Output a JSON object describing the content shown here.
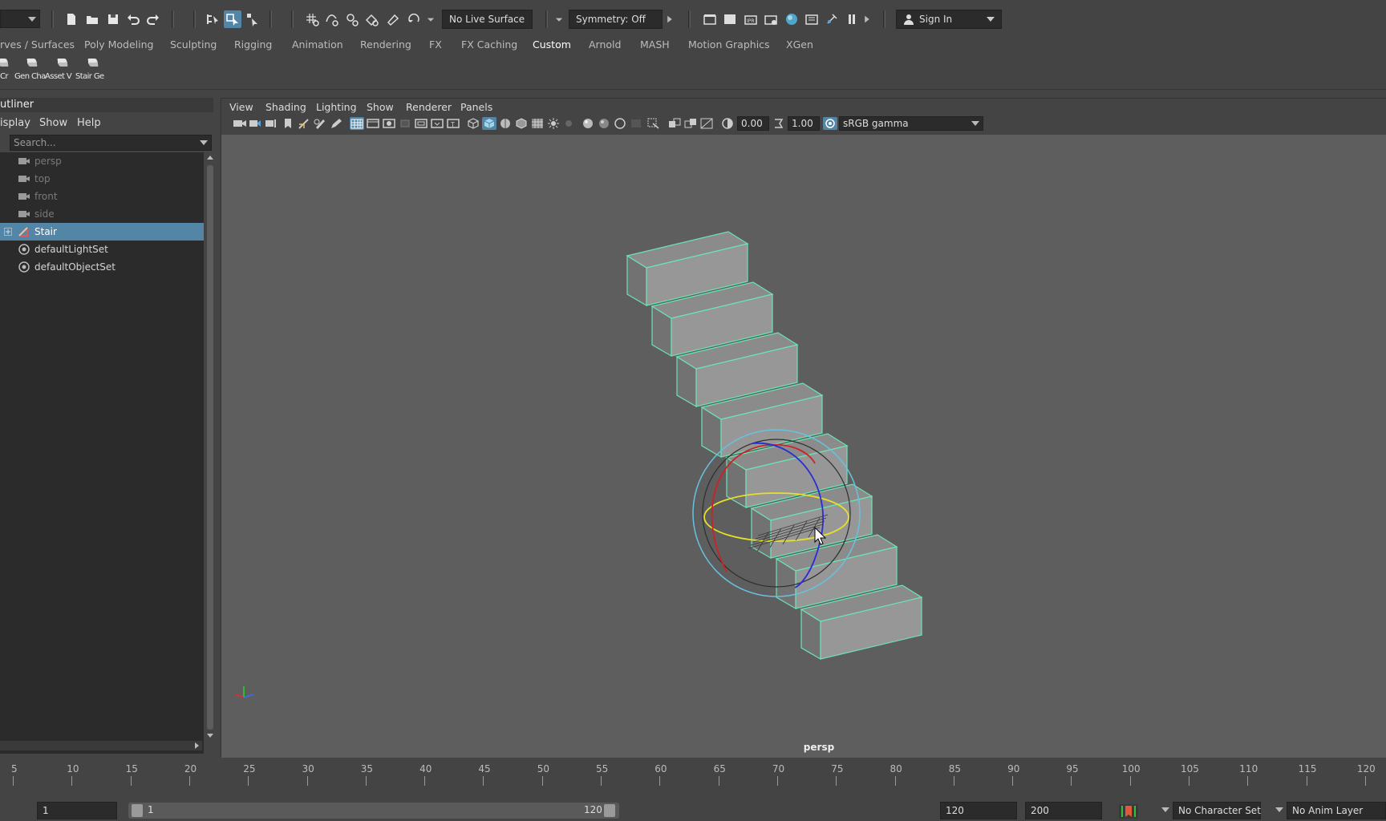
{
  "status_line": {
    "live_surface": "No Live Surface",
    "symmetry": "Symmetry: Off",
    "sign_in": "Sign In"
  },
  "shelf_tabs": [
    "rves / Surfaces",
    "Poly Modeling",
    "Sculpting",
    "Rigging",
    "Animation",
    "Rendering",
    "FX",
    "FX Caching",
    "Custom",
    "Arnold",
    "MASH",
    "Motion Graphics",
    "XGen"
  ],
  "shelf_active_tab": "Custom",
  "shelf_buttons": [
    "Cr",
    "Gen Cha",
    "Asset V",
    "Stair Ge"
  ],
  "outliner": {
    "title": "utliner",
    "menu": [
      "isplay",
      "Show",
      "Help"
    ],
    "search_placeholder": "Search...",
    "items": [
      {
        "label": "persp",
        "type": "camera"
      },
      {
        "label": "top",
        "type": "camera"
      },
      {
        "label": "front",
        "type": "camera"
      },
      {
        "label": "side",
        "type": "camera"
      },
      {
        "label": "Stair",
        "type": "transform",
        "selected": true
      },
      {
        "label": "defaultLightSet",
        "type": "set"
      },
      {
        "label": "defaultObjectSet",
        "type": "set"
      }
    ]
  },
  "viewport": {
    "menu": [
      "View",
      "Shading",
      "Lighting",
      "Show",
      "Renderer",
      "Panels"
    ],
    "exposure": "0.00",
    "gamma": "1.00",
    "color_space": "sRGB gamma",
    "camera_label": "persp"
  },
  "timeline": {
    "ticks": [
      "5",
      "10",
      "15",
      "20",
      "25",
      "30",
      "35",
      "40",
      "45",
      "50",
      "55",
      "60",
      "65",
      "70",
      "75",
      "80",
      "85",
      "90",
      "95",
      "100",
      "105",
      "110",
      "115",
      "120"
    ]
  },
  "range": {
    "current_frame": "1",
    "range_start": "1",
    "range_end": "120",
    "anim_end": "120",
    "anim_max": "200",
    "character_set": "No Character Set",
    "anim_layer": "No Anim Layer"
  },
  "colors": {
    "selection": "#5285a6",
    "wireframe_highlight": "#6de3b4",
    "viewport_bg": "#5e5e5e"
  }
}
